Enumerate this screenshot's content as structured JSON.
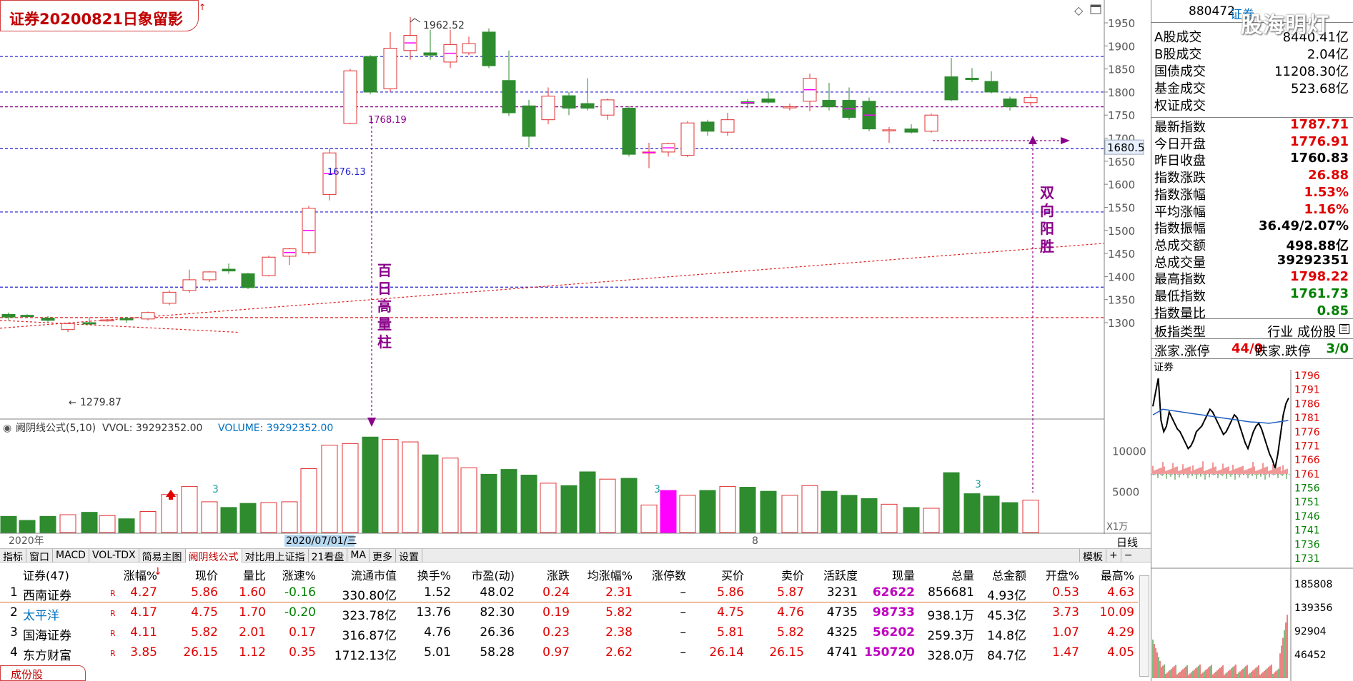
{
  "title": "证券20200821日象留影",
  "chart_top_right_icons": [
    "diamond-icon",
    "window-icon"
  ],
  "main_chart": {
    "price_axis": [
      "1950",
      "1900",
      "1850",
      "1800",
      "1750",
      "1700",
      "1650",
      "1600",
      "1550",
      "1500",
      "1450",
      "1400",
      "1350",
      "1300"
    ],
    "price_marker": "1680.5",
    "labels": {
      "high": "1962.52",
      "low": "1279.87",
      "level1": "1768.19",
      "level2": "1676.13"
    },
    "annotations": {
      "vertical_text_1": "百日高量柱",
      "vertical_text_2": "双向阳胜"
    }
  },
  "volume_panel": {
    "header_name": "阙阴线公式(5,10)",
    "vvol_label": "VVOL: 39292352.00",
    "volume_label": "VOLUME: 39292352.00",
    "axis": [
      "10000",
      "5000"
    ],
    "unit": "X1万",
    "markers": [
      "3",
      "3",
      "3"
    ]
  },
  "date_axis": {
    "year": "2020年",
    "date": "2020/07/01/三",
    "month": "8"
  },
  "period": "日线",
  "tabs": [
    "指标",
    "窗口",
    "MACD",
    "VOL-TDX",
    "简易主图",
    "阙阴线公式",
    "对比用上证指",
    "21看盘",
    "MA",
    "更多",
    "设置"
  ],
  "active_tab": "阙阴线公式",
  "tabs_right": [
    "模板",
    "+",
    "−"
  ],
  "table": {
    "headers": [
      "证券(47)",
      "涨幅%",
      "现价",
      "量比",
      "涨速%",
      "流通市值",
      "换手%",
      "市盈(动)",
      "涨跌",
      "均涨幅%",
      "涨停数",
      "买价",
      "卖价",
      "活跃度",
      "现量",
      "总量",
      "总金额",
      "开盘%",
      "最高%"
    ],
    "rows": [
      {
        "idx": "1",
        "name": "西南证券",
        "flag": "R",
        "chg": "4.27",
        "price": "5.86",
        "vr": "1.60",
        "speed": "-0.16",
        "mcap": "330.80亿",
        "turn": "1.52",
        "pe": "48.02",
        "diff": "0.24",
        "avg": "2.31",
        "limit": "–",
        "bid": "5.86",
        "ask": "5.87",
        "active": "3231",
        "now": "62622",
        "vol": "856681",
        "amt": "4.93亿",
        "open": "0.53",
        "high": "4.63"
      },
      {
        "idx": "2",
        "name": "太平洋",
        "flag": "R",
        "chg": "4.17",
        "price": "4.75",
        "vr": "1.70",
        "speed": "-0.20",
        "mcap": "323.78亿",
        "turn": "13.76",
        "pe": "82.30",
        "diff": "0.19",
        "avg": "5.82",
        "limit": "–",
        "bid": "4.75",
        "ask": "4.76",
        "active": "4735",
        "now": "98733",
        "vol": "938.1万",
        "amt": "45.3亿",
        "open": "3.73",
        "high": "10.09"
      },
      {
        "idx": "3",
        "name": "国海证券",
        "flag": "R",
        "chg": "4.11",
        "price": "5.82",
        "vr": "2.01",
        "speed": "0.17",
        "mcap": "316.87亿",
        "turn": "4.76",
        "pe": "26.36",
        "diff": "0.23",
        "avg": "2.38",
        "limit": "–",
        "bid": "5.81",
        "ask": "5.82",
        "active": "4325",
        "now": "56202",
        "vol": "259.3万",
        "amt": "14.8亿",
        "open": "1.07",
        "high": "4.29"
      },
      {
        "idx": "4",
        "name": "东方财富",
        "flag": "R",
        "chg": "3.85",
        "price": "26.15",
        "vr": "1.12",
        "speed": "0.35",
        "mcap": "1712.13亿",
        "turn": "5.01",
        "pe": "58.28",
        "diff": "0.97",
        "avg": "2.62",
        "limit": "–",
        "bid": "26.14",
        "ask": "26.15",
        "active": "4741",
        "now": "150720",
        "vol": "328.0万",
        "amt": "84.7亿",
        "open": "1.47",
        "high": "4.05"
      }
    ]
  },
  "bottom_tab": "成份股",
  "right_panel": {
    "code": "880472",
    "name": "证券",
    "watermark": "股海明灯",
    "stats": [
      {
        "k": "A股成交",
        "v": "8440.41亿",
        "color": "blk"
      },
      {
        "k": "B股成交",
        "v": "2.04亿",
        "color": "blk"
      },
      {
        "k": "国债成交",
        "v": "11208.30亿",
        "color": "blk"
      },
      {
        "k": "基金成交",
        "v": "523.68亿",
        "color": "blk"
      },
      {
        "k": "权证成交",
        "v": "",
        "color": "blk"
      }
    ],
    "quotes": [
      {
        "k": "最新指数",
        "v": "1787.71",
        "color": "red"
      },
      {
        "k": "今日开盘",
        "v": "1776.91",
        "color": "red"
      },
      {
        "k": "昨日收盘",
        "v": "1760.83",
        "color": "blk"
      },
      {
        "k": "指数涨跌",
        "v": "26.88",
        "color": "red"
      },
      {
        "k": "指数涨幅",
        "v": "1.53%",
        "color": "red"
      },
      {
        "k": "平均涨幅",
        "v": "1.16%",
        "color": "red"
      },
      {
        "k": "指数振幅",
        "v": "36.49/2.07%",
        "color": "blk"
      },
      {
        "k": "总成交额",
        "v": "498.88亿",
        "color": "blk"
      },
      {
        "k": "总成交量",
        "v": "39292351",
        "color": "blk"
      },
      {
        "k": "最高指数",
        "v": "1798.22",
        "color": "red"
      },
      {
        "k": "最低指数",
        "v": "1761.73",
        "color": "green"
      },
      {
        "k": "指数量比",
        "v": "0.85",
        "color": "green"
      }
    ],
    "board_type_label": "板指类型",
    "board_type_value": "行业 成份股",
    "rise_label": "涨家.涨停",
    "rise_value": "44/0",
    "fall_label": "跌家.跌停",
    "fall_value": "3/0",
    "mini_chart_name": "证券",
    "mini_price_axis": [
      "1796",
      "1791",
      "1786",
      "1781",
      "1776",
      "1771",
      "1766",
      "1761",
      "1756",
      "1751",
      "1746",
      "1741",
      "1736",
      "1731"
    ],
    "mini_vol_axis": [
      "185808",
      "139356",
      "92904",
      "46452"
    ]
  },
  "colors": {
    "up": "#e03030",
    "down": "#2e8b2e",
    "magenta": "#ff00ff",
    "dash_blue": "#2020d0",
    "dash_red": "#e02020",
    "purple": "#8a008a"
  }
}
